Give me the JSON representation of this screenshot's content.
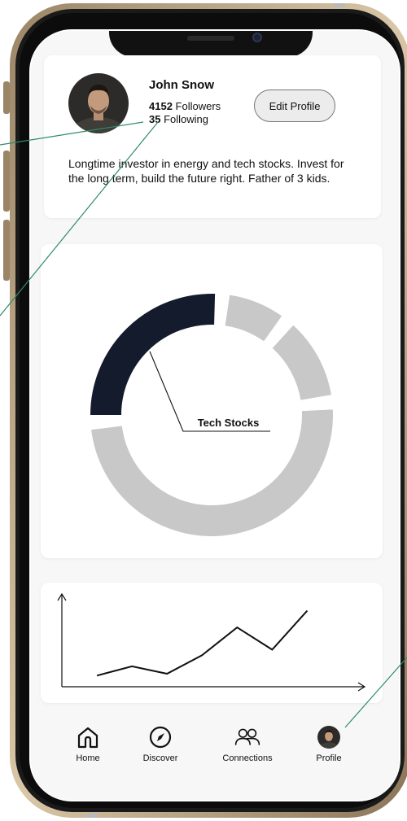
{
  "profile": {
    "name": "John Snow",
    "followers_count": "4152",
    "followers_label": "Followers",
    "following_count": "35",
    "following_label": "Following",
    "edit_button_label": "Edit Profile",
    "bio": "Longtime investor in energy and tech stocks. Invest for the long term, build the future right. Father of 3 kids."
  },
  "chart_data": [
    {
      "type": "pie",
      "style": "donut",
      "labels": [
        "Tech Stocks",
        "",
        "",
        ""
      ],
      "values": [
        24,
        7,
        10,
        46
      ],
      "highlighted_label": "Tech Stocks",
      "colors": [
        "#141b2d",
        "#c8c8c8",
        "#c8c8c8",
        "#c8c8c8"
      ]
    },
    {
      "type": "line",
      "x": [
        1,
        2,
        3,
        4,
        5,
        6,
        7
      ],
      "y": [
        1.2,
        2.2,
        1.4,
        3.4,
        6.4,
        4.0,
        8.2
      ],
      "xlabel": "",
      "ylabel": "",
      "ylim": [
        0,
        10
      ],
      "xlim": [
        0,
        8.5
      ],
      "grid": false
    }
  ],
  "nav": {
    "home": "Home",
    "discover": "Discover",
    "connections": "Connections",
    "profile": "Profile"
  },
  "colors": {
    "accent_dark": "#141b2d",
    "slice_gray": "#c8c8c8",
    "annotation_line": "#2e8b6a"
  }
}
